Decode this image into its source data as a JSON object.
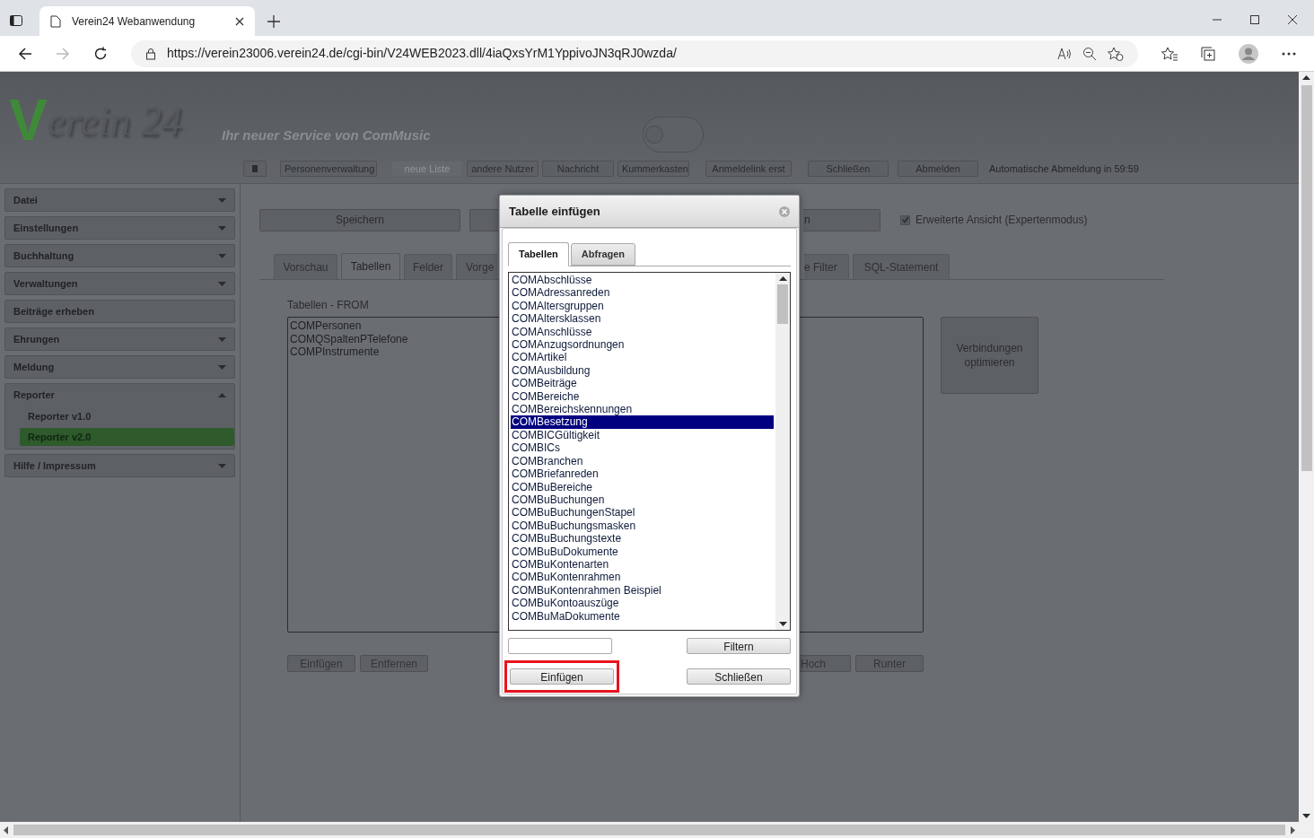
{
  "browser": {
    "tab_title": "Verein24 Webanwendung",
    "url": "https://verein23006.verein24.de/cgi-bin/V24WEB2023.dll/4iaQxsYrM1YppivoJN3qRJ0wzda/"
  },
  "header": {
    "logo_initial": "V",
    "logo_rest": "erein 24",
    "tagline": "Ihr neuer Service von ComMusic",
    "toggle_on": false,
    "toolbar": [
      {
        "label": "Personenverwaltung",
        "disabled": false
      },
      {
        "label": "neue Liste",
        "disabled": true
      },
      {
        "label": "andere Nutzer",
        "disabled": false
      },
      {
        "label": "Nachricht",
        "disabled": false
      },
      {
        "label": "Kummerkasten",
        "disabled": false
      },
      {
        "label": "Anmeldelink erst",
        "disabled": false
      },
      {
        "label": "Schließen",
        "disabled": false
      },
      {
        "label": "Abmelden",
        "disabled": false
      }
    ],
    "status": "Automatische Abmeldung in 59:59"
  },
  "sidebar": [
    {
      "label": "Datei",
      "expandable": true,
      "expanded": false
    },
    {
      "label": "Einstellungen",
      "expandable": true,
      "expanded": false
    },
    {
      "label": "Buchhaltung",
      "expandable": true,
      "expanded": false
    },
    {
      "label": "Verwaltungen",
      "expandable": true,
      "expanded": false
    },
    {
      "label": "Beiträge erheben",
      "expandable": false
    },
    {
      "label": "Ehrungen",
      "expandable": true,
      "expanded": false
    },
    {
      "label": "Meldung",
      "expandable": true,
      "expanded": false
    },
    {
      "label": "Reporter",
      "expandable": true,
      "expanded": true,
      "children": [
        {
          "label": "Reporter v1.0",
          "selected": false
        },
        {
          "label": "Reporter v2.0",
          "selected": true
        }
      ]
    },
    {
      "label": "Hilfe / Impressum",
      "expandable": true,
      "expanded": false
    }
  ],
  "main": {
    "save_button": "Speichern",
    "cut_button": "n",
    "expert_mode": {
      "label": "Erweiterte Ansicht (Expertenmodus)",
      "checked": true
    },
    "tabs_left": [
      {
        "label": "Vorschau",
        "selected": false
      },
      {
        "label": "Tabellen",
        "selected": true
      },
      {
        "label": "Felder",
        "selected": false
      },
      {
        "label": "Vorge",
        "selected": false
      }
    ],
    "tabs_right": [
      {
        "label": "e Filter",
        "selected": false
      },
      {
        "label": "SQL-Statement",
        "selected": false
      }
    ],
    "from_label": "Tabellen - FROM",
    "from_tables": [
      "COMPersonen",
      "COMQSpaltenPTelefone",
      "COMPInstrumente"
    ],
    "optimize_button": "Verbindungen optimieren",
    "buttons_left": [
      "Einfügen",
      "Entfernen"
    ],
    "buttons_right": [
      "Hoch",
      "Runter"
    ]
  },
  "dialog": {
    "title": "Tabelle einfügen",
    "tabs": [
      {
        "label": "Tabellen",
        "selected": true
      },
      {
        "label": "Abfragen",
        "selected": false
      }
    ],
    "items": [
      {
        "label": "COMAbschlüsse",
        "selected": false
      },
      {
        "label": "COMAdressanreden",
        "selected": false
      },
      {
        "label": "COMAltersgruppen",
        "selected": false
      },
      {
        "label": "COMAltersklassen",
        "selected": false
      },
      {
        "label": "COMAnschlüsse",
        "selected": false
      },
      {
        "label": "COMAnzugsordnungen",
        "selected": false
      },
      {
        "label": "COMArtikel",
        "selected": false
      },
      {
        "label": "COMAusbildung",
        "selected": false
      },
      {
        "label": "COMBeiträge",
        "selected": false
      },
      {
        "label": "COMBereiche",
        "selected": false
      },
      {
        "label": "COMBereichskennungen",
        "selected": false
      },
      {
        "label": "COMBesetzung",
        "selected": true
      },
      {
        "label": "COMBICGültigkeit",
        "selected": false
      },
      {
        "label": "COMBICs",
        "selected": false
      },
      {
        "label": "COMBranchen",
        "selected": false
      },
      {
        "label": "COMBriefanreden",
        "selected": false
      },
      {
        "label": "COMBuBereiche",
        "selected": false
      },
      {
        "label": "COMBuBuchungen",
        "selected": false
      },
      {
        "label": "COMBuBuchungenStapel",
        "selected": false
      },
      {
        "label": "COMBuBuchungsmasken",
        "selected": false
      },
      {
        "label": "COMBuBuchungstexte",
        "selected": false
      },
      {
        "label": "COMBuBuDokumente",
        "selected": false
      },
      {
        "label": "COMBuKontenarten",
        "selected": false
      },
      {
        "label": "COMBuKontenrahmen",
        "selected": false
      },
      {
        "label": "COMBuKontenrahmen Beispiel",
        "selected": false
      },
      {
        "label": "COMBuKontoauszüge",
        "selected": false
      },
      {
        "label": "COMBuMaDokumente",
        "selected": false
      }
    ],
    "filter_button": "Filtern",
    "insert_button": {
      "label": "Einfügen",
      "highlighted": true
    },
    "close_button": "Schließen"
  }
}
